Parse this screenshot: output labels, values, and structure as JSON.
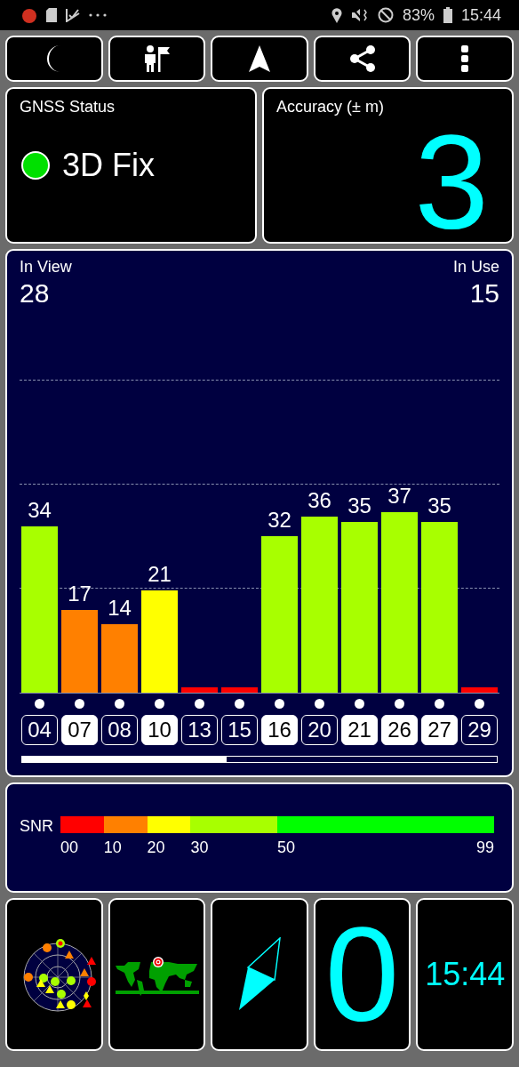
{
  "status_bar": {
    "battery": "83%",
    "time": "15:44"
  },
  "toolbar": {
    "buttons": [
      {
        "kind": "night"
      },
      {
        "kind": "guide"
      },
      {
        "kind": "navigate"
      },
      {
        "kind": "share"
      },
      {
        "kind": "more"
      }
    ]
  },
  "gnss_status": {
    "title": "GNSS Status",
    "value": "3D Fix",
    "color": "#00e000"
  },
  "accuracy": {
    "title": "Accuracy (± m)",
    "value": "3"
  },
  "satellites": {
    "in_view_label": "In View",
    "in_view": "28",
    "in_use_label": "In Use",
    "in_use": "15",
    "items": [
      {
        "id": "04",
        "snr": "34",
        "color": "#a8ff00",
        "in_use": false
      },
      {
        "id": "07",
        "snr": "17",
        "color": "#ff8000",
        "in_use": true
      },
      {
        "id": "08",
        "snr": "14",
        "color": "#ff8000",
        "in_use": false
      },
      {
        "id": "10",
        "snr": "21",
        "color": "#ffff00",
        "in_use": true
      },
      {
        "id": "13",
        "color": "#ff0000",
        "in_use": false
      },
      {
        "id": "15",
        "color": "#ff0000",
        "in_use": false
      },
      {
        "id": "16",
        "snr": "32",
        "color": "#a8ff00",
        "in_use": true
      },
      {
        "id": "20",
        "snr": "36",
        "color": "#a8ff00",
        "in_use": false
      },
      {
        "id": "21",
        "snr": "35",
        "color": "#a8ff00",
        "in_use": true
      },
      {
        "id": "26",
        "snr": "37",
        "color": "#a8ff00",
        "in_use": true
      },
      {
        "id": "27",
        "snr": "35",
        "color": "#a8ff00",
        "in_use": true
      },
      {
        "id": "29",
        "color": "#ff0000",
        "in_use": false
      }
    ]
  },
  "snr_legend": {
    "label": "SNR",
    "segments": [
      {
        "from": "00",
        "color": "#ff0000"
      },
      {
        "from": "10",
        "color": "#ff8000"
      },
      {
        "from": "20",
        "color": "#ffff00"
      },
      {
        "from": "30",
        "color": "#a8ff00"
      },
      {
        "from": "50",
        "color": "#00ff00"
      }
    ],
    "end": "99"
  },
  "tiles": [
    {
      "kind": "radar"
    },
    {
      "kind": "map"
    },
    {
      "kind": "compass"
    },
    {
      "kind": "number",
      "value": "0"
    },
    {
      "kind": "time",
      "value": "15:44"
    }
  ]
}
